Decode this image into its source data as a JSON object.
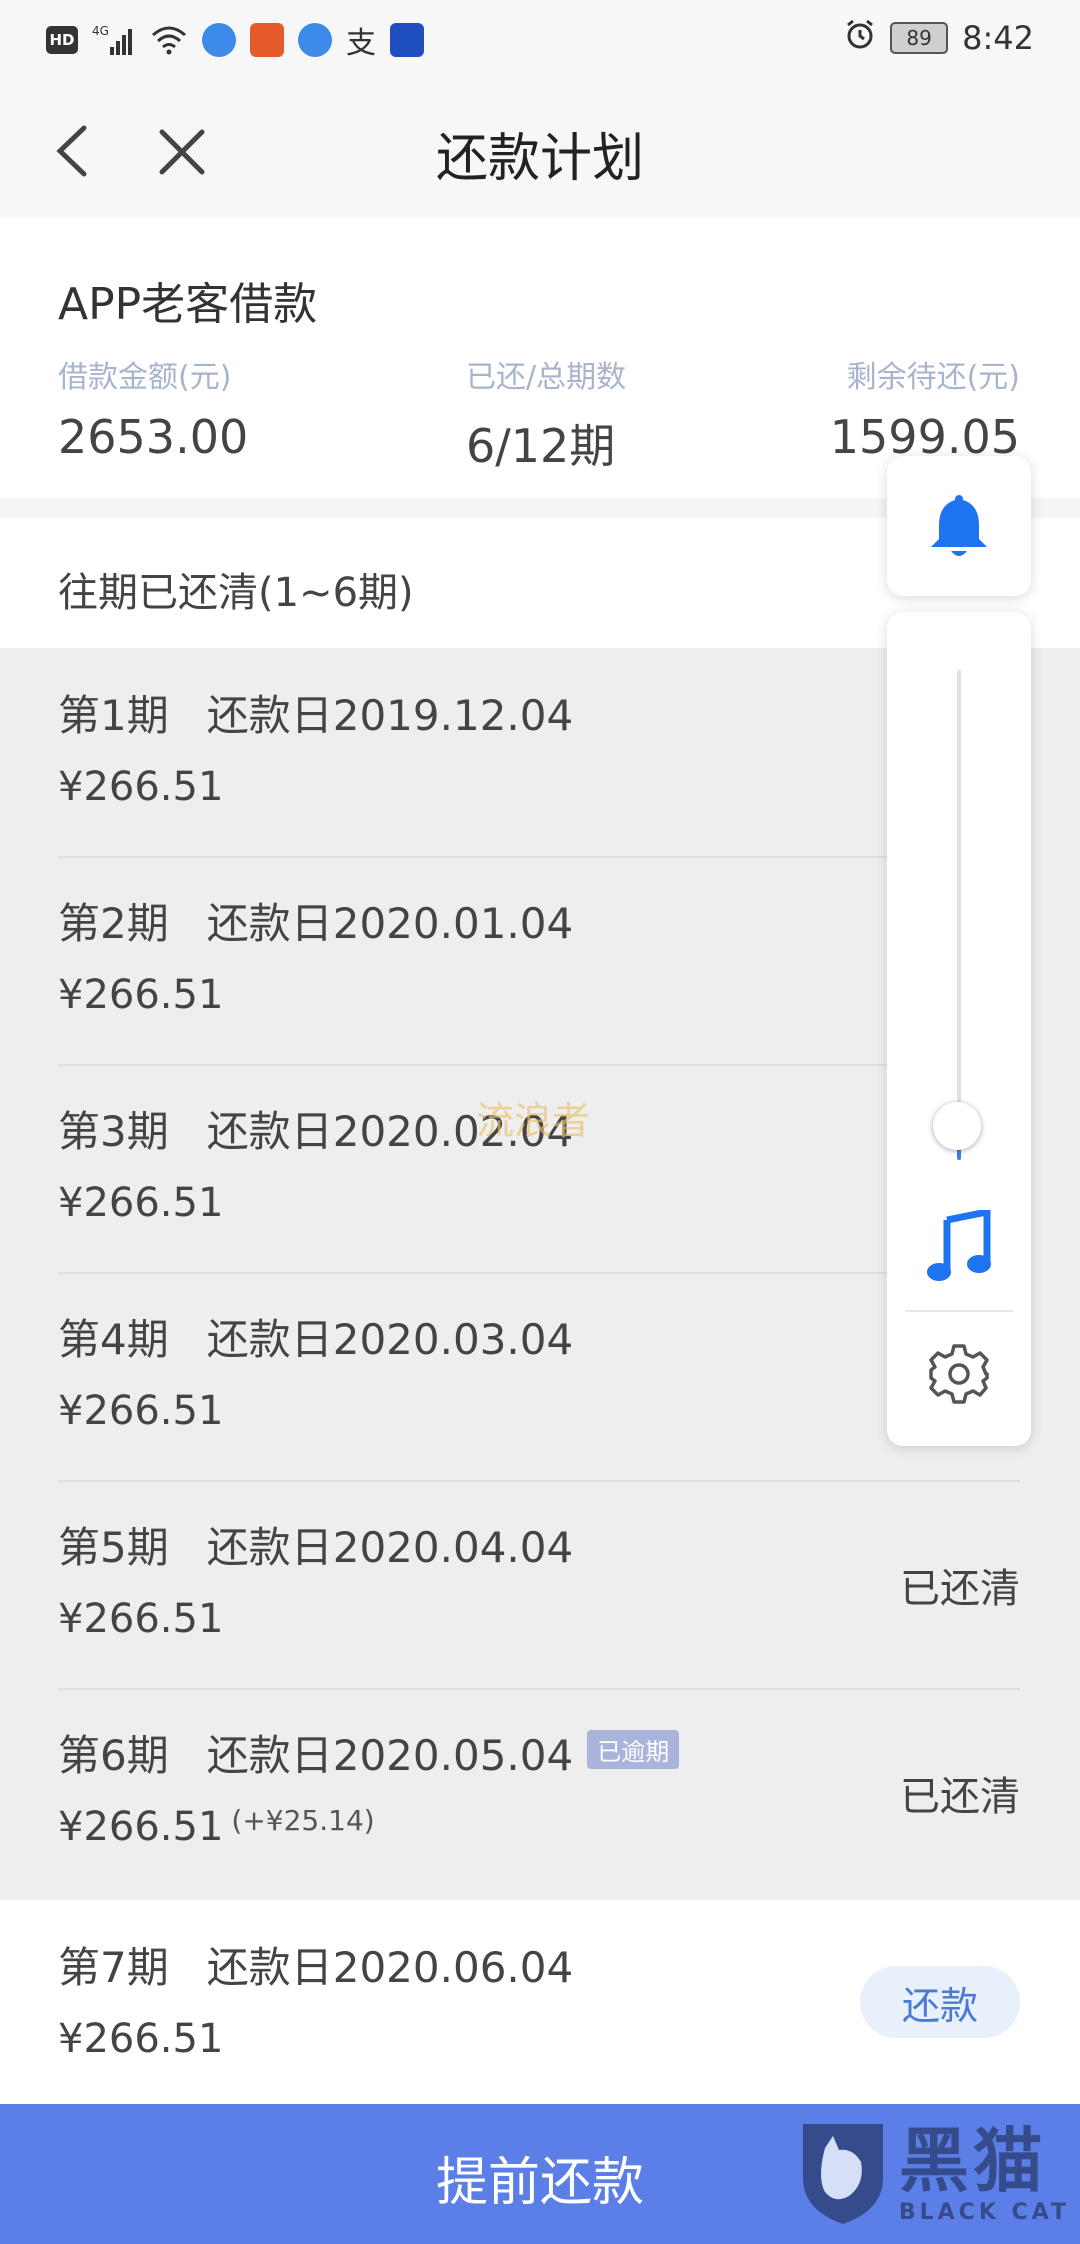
{
  "statusbar": {
    "hd": "HD",
    "signal": "4G",
    "zhi": "支",
    "battery": "89",
    "time": "8:42"
  },
  "nav": {
    "title": "还款计划"
  },
  "summary": {
    "title": "APP老客借款",
    "stats": [
      {
        "label": "借款金额(元)",
        "value": "2653.00"
      },
      {
        "label": "已还/总期数",
        "value": "6/12期"
      },
      {
        "label": "剩余待还(元)",
        "value": "1599.05"
      }
    ]
  },
  "paid_section": {
    "title": "往期已还清(1~6期)"
  },
  "installments": [
    {
      "period": "第1期",
      "date": "还款日2019.12.04",
      "amount": "¥266.51",
      "status": ""
    },
    {
      "period": "第2期",
      "date": "还款日2020.01.04",
      "amount": "¥266.51",
      "status": ""
    },
    {
      "period": "第3期",
      "date": "还款日2020.02.04",
      "amount": "¥266.51",
      "status": ""
    },
    {
      "period": "第4期",
      "date": "还款日2020.03.04",
      "amount": "¥266.51",
      "status": ""
    },
    {
      "period": "第5期",
      "date": "还款日2020.04.04",
      "amount": "¥266.51",
      "status": "已还清"
    },
    {
      "period": "第6期",
      "date": "还款日2020.05.04",
      "tag": "已逾期",
      "amount": "¥266.51",
      "extra": "(+¥25.14)",
      "status": "已还清"
    }
  ],
  "upcoming": {
    "period": "第7期",
    "date": "还款日2020.06.04",
    "amount": "¥266.51",
    "button": "还款"
  },
  "bottom_button": "提前还款",
  "watermark": {
    "center": "流浪者",
    "brand_cn": "黑猫",
    "brand_en": "BLACK CAT"
  },
  "floating_panel": {
    "volume_level": 0.07
  },
  "colors": {
    "accent": "#5b7fe6",
    "icon_blue": "#1e74f0",
    "label_grey": "#a8b4cc"
  }
}
